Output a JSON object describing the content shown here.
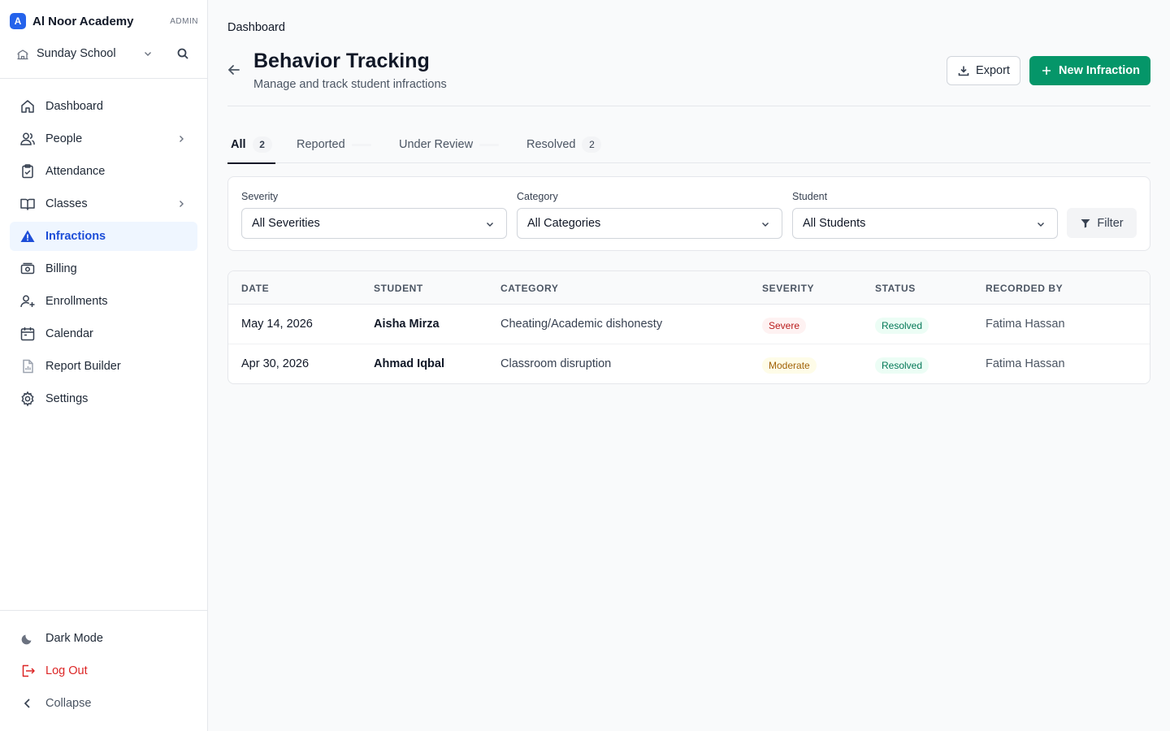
{
  "colors": {
    "accent": "#2563eb",
    "primary_button": "#059669",
    "danger": "#dc2626"
  },
  "brand": {
    "logo_letter": "A",
    "name": "Al Noor Academy",
    "role": "ADMIN"
  },
  "school": {
    "name": "Sunday School",
    "icon": "school-building-icon"
  },
  "sidebar": {
    "items": [
      {
        "label": "Dashboard",
        "icon": "home-icon"
      },
      {
        "label": "People",
        "icon": "users-icon"
      },
      {
        "label": "Attendance",
        "icon": "clipboard-check-icon"
      },
      {
        "label": "Classes",
        "icon": "book-open-icon"
      },
      {
        "label": "Infractions",
        "icon": "warning-triangle-icon",
        "active": true
      },
      {
        "label": "Billing",
        "icon": "billing-icon"
      },
      {
        "label": "Enrollments",
        "icon": "user-plus-icon"
      },
      {
        "label": "Calendar",
        "icon": "calendar-icon"
      },
      {
        "label": "Report Builder",
        "icon": "report-icon"
      },
      {
        "label": "Settings",
        "icon": "gear-icon"
      }
    ],
    "bottom": [
      {
        "label": "Dark Mode",
        "icon": "moon-icon"
      },
      {
        "label": "Log Out",
        "icon": "logout-icon"
      },
      {
        "label": "Collapse",
        "icon": "chevron-left-icon"
      }
    ]
  },
  "header": {
    "breadcrumb": "Dashboard",
    "title": "Behavior Tracking",
    "subtitle": "Manage and track student infractions",
    "export_label": "Export",
    "new_label": "New Infraction"
  },
  "tabs": [
    {
      "label": "All",
      "count": "2",
      "active": true
    },
    {
      "label": "Reported",
      "count": ""
    },
    {
      "label": "Under Review",
      "count": ""
    },
    {
      "label": "Resolved",
      "count": "2"
    }
  ],
  "filters": {
    "severity": {
      "label": "Severity",
      "value": "All Severities"
    },
    "category": {
      "label": "Category",
      "value": "All Categories"
    },
    "student": {
      "label": "Student",
      "value": "All Students"
    },
    "button_label": "Filter"
  },
  "table": {
    "columns": [
      "DATE",
      "STUDENT",
      "CATEGORY",
      "SEVERITY",
      "STATUS",
      "RECORDED BY"
    ],
    "rows": [
      {
        "date": "May 14, 2026",
        "student": "Aisha Mirza",
        "category": "Cheating/Academic dishonesty",
        "severity": "Severe",
        "status": "Resolved",
        "recorded_by": "Fatima Hassan"
      },
      {
        "date": "Apr 30, 2026",
        "student": "Ahmad Iqbal",
        "category": "Classroom disruption",
        "severity": "Moderate",
        "status": "Resolved",
        "recorded_by": "Fatima Hassan"
      }
    ]
  }
}
